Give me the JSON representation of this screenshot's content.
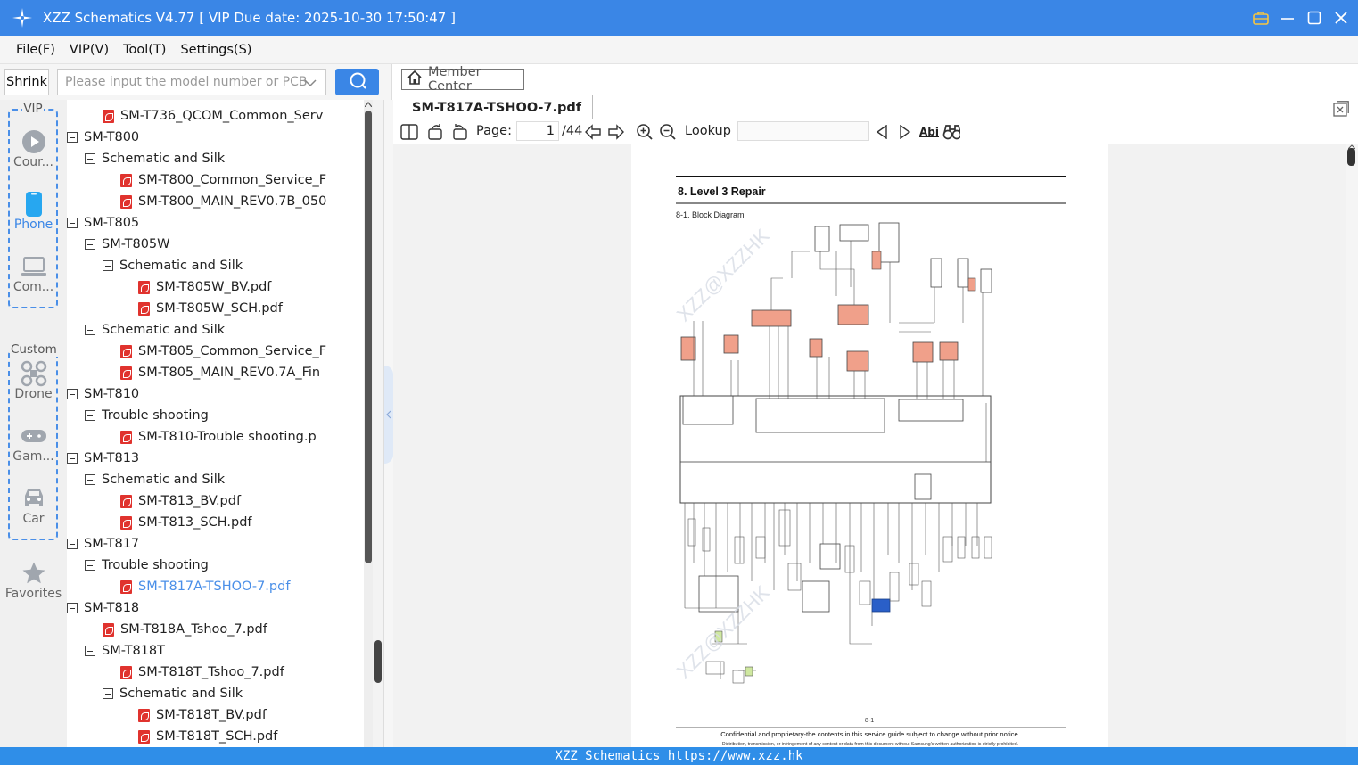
{
  "window": {
    "title": "XZZ Schematics V4.77 [ VIP Due date: 2025-10-30 17:50:47 ]"
  },
  "menu": [
    "File(F)",
    "VIP(V)",
    "Tool(T)",
    "Settings(S)"
  ],
  "search": {
    "shrink_label": "Shrink",
    "placeholder": "Please input the model number or PCB"
  },
  "nav": {
    "vip_label": "VIP",
    "custom_label": "Custom",
    "items": [
      "Cour...",
      "Phone",
      "Com...",
      "Drone",
      "Gam...",
      "Car",
      "Favorites"
    ]
  },
  "tree": [
    {
      "label": "SM-T736_QCOM_Common_Serv",
      "type": "pdf",
      "indent": 1
    },
    {
      "label": "SM-T800",
      "type": "folder",
      "indent": 0
    },
    {
      "label": "Schematic and Silk",
      "type": "folder",
      "indent": 1
    },
    {
      "label": "SM-T800_Common_Service_F",
      "type": "pdf",
      "indent": 2
    },
    {
      "label": "SM-T800_MAIN_REV0.7B_050",
      "type": "pdf",
      "indent": 2
    },
    {
      "label": "SM-T805",
      "type": "folder",
      "indent": 0
    },
    {
      "label": "SM-T805W",
      "type": "folder",
      "indent": 1
    },
    {
      "label": "Schematic and Silk",
      "type": "folder",
      "indent": 2
    },
    {
      "label": "SM-T805W_BV.pdf",
      "type": "pdf",
      "indent": 3
    },
    {
      "label": "SM-T805W_SCH.pdf",
      "type": "pdf",
      "indent": 3
    },
    {
      "label": "Schematic and Silk",
      "type": "folder",
      "indent": 1
    },
    {
      "label": "SM-T805_Common_Service_F",
      "type": "pdf",
      "indent": 2
    },
    {
      "label": "SM-T805_MAIN_REV0.7A_Fin",
      "type": "pdf",
      "indent": 2
    },
    {
      "label": "SM-T810",
      "type": "folder",
      "indent": 0
    },
    {
      "label": "Trouble shooting",
      "type": "folder",
      "indent": 1
    },
    {
      "label": "SM-T810-Trouble shooting.p",
      "type": "pdf",
      "indent": 2
    },
    {
      "label": "SM-T813",
      "type": "folder",
      "indent": 0
    },
    {
      "label": "Schematic and Silk",
      "type": "folder",
      "indent": 1
    },
    {
      "label": "SM-T813_BV.pdf",
      "type": "pdf",
      "indent": 2
    },
    {
      "label": "SM-T813_SCH.pdf",
      "type": "pdf",
      "indent": 2
    },
    {
      "label": "SM-T817",
      "type": "folder",
      "indent": 0
    },
    {
      "label": "Trouble shooting",
      "type": "folder",
      "indent": 1
    },
    {
      "label": "SM-T817A-TSHOO-7.pdf",
      "type": "pdf",
      "indent": 2,
      "selected": true
    },
    {
      "label": "SM-T818",
      "type": "folder",
      "indent": 0
    },
    {
      "label": "SM-T818A_Tshoo_7.pdf",
      "type": "pdf",
      "indent": 1
    },
    {
      "label": "SM-T818T",
      "type": "folder",
      "indent": 1
    },
    {
      "label": "SM-T818T_Tshoo_7.pdf",
      "type": "pdf",
      "indent": 2
    },
    {
      "label": "Schematic and Silk",
      "type": "folder",
      "indent": 2
    },
    {
      "label": "SM-T818T_BV.pdf",
      "type": "pdf",
      "indent": 3
    },
    {
      "label": "SM-T818T_SCH.pdf",
      "type": "pdf",
      "indent": 3
    }
  ],
  "viewer": {
    "member_center": "Member Center",
    "tab_title": "SM-T817A-TSHOO-7.pdf",
    "page_label": "Page:",
    "page_current": "1",
    "page_total": "/44",
    "lookup_label": "Lookup",
    "abi_label": "Abi"
  },
  "document": {
    "heading": "8.  Level  3  Repair",
    "subheading": "8-1.  Block  Diagram",
    "page_number": "8-1",
    "footer_line1": "Confidential and proprietary-the contents in this service guide subject to change without prior notice.",
    "footer_line2": "Distribution, transmission, or infringement of any content or data from this document without Samsung's written authorization is strictly prohibited.",
    "watermark": "XZZ@XZZHK"
  },
  "footer": {
    "text": "XZZ Schematics https://www.xzz.hk"
  },
  "colors": {
    "accent": "#3a86e6",
    "selected": "#4a8fe8",
    "pdf_red": "#e0332e",
    "block_salmon": "#f0a08a"
  }
}
